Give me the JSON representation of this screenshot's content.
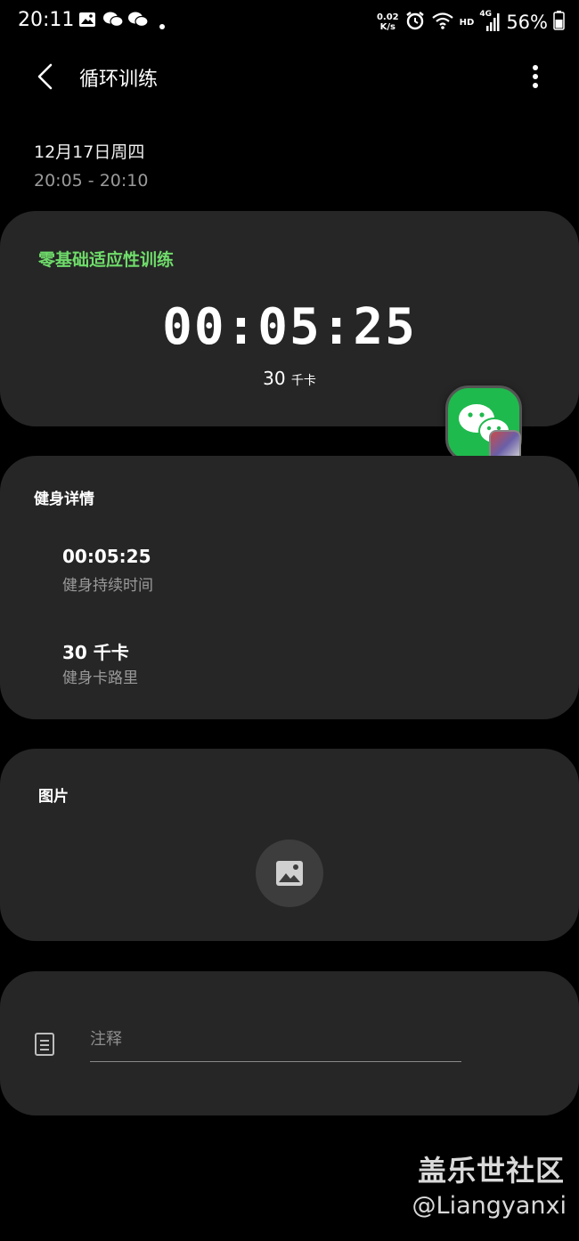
{
  "status_bar": {
    "time": "20:11",
    "net_speed_value": "0.02",
    "net_speed_unit": "K/s",
    "hd": "HD",
    "network": "4G",
    "battery_percent": "56%",
    "icons": [
      "image-icon",
      "wechat-icon",
      "wechat-icon",
      "dot-icon",
      "alarm-icon",
      "wifi-icon",
      "signal-icon",
      "battery-icon"
    ]
  },
  "app_bar": {
    "title": "循环训练",
    "back_icon": "chevron-left-icon",
    "more_icon": "more-vertical-icon"
  },
  "session": {
    "date": "12月17日周四",
    "time_range": "20:05 - 20:10"
  },
  "workout": {
    "name": "零基础适应性训练",
    "duration": "00:05:25",
    "kcal_value": "30",
    "kcal_unit": "千卡",
    "name_color": "#6fdc6a"
  },
  "details": {
    "title": "健身详情",
    "items": [
      {
        "value": "00:05:25",
        "label": "健身持续时间"
      },
      {
        "value": "30 千卡",
        "label": "健身卡路里"
      }
    ]
  },
  "images": {
    "title": "图片",
    "add_icon": "image-icon"
  },
  "notes": {
    "placeholder": "注释",
    "icon": "note-icon"
  },
  "watermark": {
    "title": "盖乐世社区",
    "handle": "@Liangyanxi"
  },
  "floating_bubble": {
    "icon": "wechat-icon",
    "color": "#1fba4d"
  }
}
